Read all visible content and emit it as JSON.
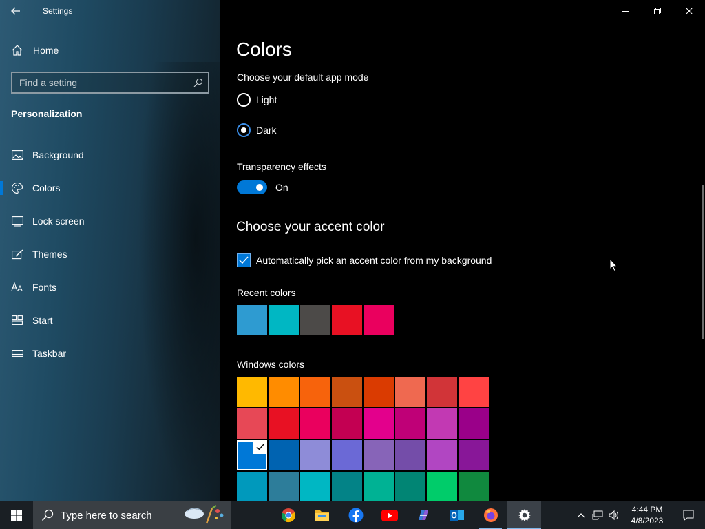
{
  "window": {
    "title": "Settings",
    "back_icon": "arrow-left-icon",
    "controls": [
      "minimize-icon",
      "restore-icon",
      "close-icon"
    ]
  },
  "sidebar": {
    "home_label": "Home",
    "search_placeholder": "Find a setting",
    "section_label": "Personalization",
    "items": [
      {
        "label": "Background",
        "icon": "picture-icon",
        "active": false
      },
      {
        "label": "Colors",
        "icon": "palette-icon",
        "active": true
      },
      {
        "label": "Lock screen",
        "icon": "lock-screen-icon",
        "active": false
      },
      {
        "label": "Themes",
        "icon": "themes-brush-icon",
        "active": false
      },
      {
        "label": "Fonts",
        "icon": "fonts-icon",
        "active": false
      },
      {
        "label": "Start",
        "icon": "start-grid-icon",
        "active": false
      },
      {
        "label": "Taskbar",
        "icon": "taskbar-icon",
        "active": false
      }
    ]
  },
  "main": {
    "title": "Colors",
    "app_mode_heading": "Choose your default app mode",
    "app_mode_options": [
      {
        "label": "Light",
        "checked": false
      },
      {
        "label": "Dark",
        "checked": true
      }
    ],
    "transparency_heading": "Transparency effects",
    "transparency_state": "On",
    "accent_heading": "Choose your accent color",
    "auto_pick_label": "Automatically pick an accent color from my background",
    "auto_pick_checked": true,
    "recent_colors_heading": "Recent colors",
    "recent_colors": [
      "#2e9bd1",
      "#00b7c3",
      "#4c4a48",
      "#e81123",
      "#ea005e"
    ],
    "windows_colors_heading": "Windows colors",
    "windows_colors": [
      [
        "#ffb900",
        "#ff8c00",
        "#f7630c",
        "#ca5010",
        "#da3b01",
        "#ef6950",
        "#d13438",
        "#ff4343"
      ],
      [
        "#e74856",
        "#e81123",
        "#ea005e",
        "#c30052",
        "#e3008c",
        "#bf0077",
        "#c239b3",
        "#9a0089"
      ],
      [
        "#0078d7",
        "#0063b1",
        "#8e8cd8",
        "#6b69d6",
        "#8764b8",
        "#744da9",
        "#b146c2",
        "#881798"
      ],
      [
        "#0099bc",
        "#2d7d9a",
        "#00b7c3",
        "#038387",
        "#00b294",
        "#018574",
        "#00cc6a",
        "#10893e"
      ]
    ],
    "selected_color": "#0078d7"
  },
  "taskbar": {
    "search_placeholder": "Type here to search",
    "apps": [
      {
        "name": "chrome-icon",
        "state": "normal"
      },
      {
        "name": "file-explorer-icon",
        "state": "normal"
      },
      {
        "name": "facebook-icon",
        "state": "normal"
      },
      {
        "name": "youtube-icon",
        "state": "normal"
      },
      {
        "name": "copilot-icon",
        "state": "normal"
      },
      {
        "name": "outlook-icon",
        "state": "normal"
      },
      {
        "name": "firefox-icon",
        "state": "running"
      },
      {
        "name": "settings-gear-icon",
        "state": "active"
      }
    ],
    "time": "4:44 PM",
    "date": "4/8/2023"
  }
}
